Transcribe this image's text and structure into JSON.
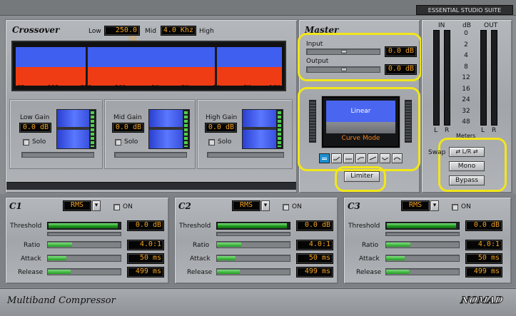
{
  "brand_tag": "ESSENTIAL STUDIO SUITE",
  "crossover": {
    "title": "Crossover",
    "low_label": "Low",
    "low_value": "250.0 Hz",
    "mid_label": "Mid",
    "mid_value": "4.0 Khz",
    "high_label": "High",
    "freq_ticks": [
      "63",
      "125",
      "250",
      "500",
      "1K",
      "2K",
      "4K",
      "8K",
      "16K"
    ],
    "bands": [
      {
        "label": "Low Gain",
        "value": "0.0 dB",
        "solo": "Solo"
      },
      {
        "label": "Mid Gain",
        "value": "0.0 dB",
        "solo": "Solo"
      },
      {
        "label": "High Gain",
        "value": "0.0 dB",
        "solo": "Solo"
      }
    ],
    "colors": {
      "upper": "#3f5ff0",
      "lower": "#f03c14"
    }
  },
  "master": {
    "title": "Master",
    "input_label": "Input",
    "input_value": "0.0 dB",
    "output_label": "Output",
    "output_value": "0.0 dB",
    "mode_value": "Linear",
    "mode_caption": "Curve Mode",
    "limiter_label": "Limiter",
    "meter_caption": "Meters",
    "in_label": "IN",
    "db_label": "dB",
    "out_label": "OUT",
    "db_scale": [
      "0",
      "2",
      "4",
      "8",
      "12",
      "16",
      "24",
      "32",
      "48"
    ],
    "l_label": "L",
    "r_label": "R",
    "swap_label": "Swap",
    "lr_button": "⇄ L/R ⇄",
    "mono_button": "Mono",
    "bypass_button": "Bypass"
  },
  "compressors": [
    {
      "title": "C1",
      "detector": "RMS",
      "on_label": "ON",
      "threshold_label": "Threshold",
      "threshold": "0.0 dB",
      "threshold_level": 0.95,
      "ratio_label": "Ratio",
      "ratio": "4.0:1",
      "attack_label": "Attack",
      "attack": "50 ms",
      "release_label": "Release",
      "release": "499 ms"
    },
    {
      "title": "C2",
      "detector": "RMS",
      "on_label": "ON",
      "threshold_label": "Threshold",
      "threshold": "0.0 dB",
      "threshold_level": 0.95,
      "ratio_label": "Ratio",
      "ratio": "4.0:1",
      "attack_label": "Attack",
      "attack": "50 ms",
      "release_label": "Release",
      "release": "499 ms"
    },
    {
      "title": "C3",
      "detector": "RMS",
      "on_label": "ON",
      "threshold_label": "Threshold",
      "threshold": "0.0 dB",
      "threshold_level": 0.95,
      "ratio_label": "Ratio",
      "ratio": "4.0:1",
      "attack_label": "Attack",
      "attack": "50 ms",
      "release_label": "Release",
      "release": "499 ms"
    }
  ],
  "footer": {
    "title": "Multiband Compressor",
    "logo": "NOMAD"
  }
}
